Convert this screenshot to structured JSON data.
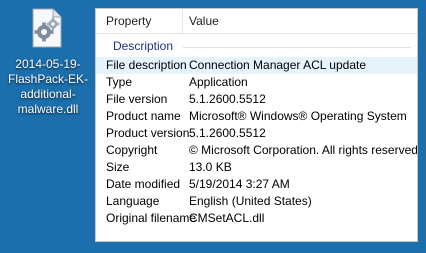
{
  "desktop_icon": {
    "icon": "dll-file-gear-icon",
    "label": "2014-05-19-FlashPack-EK-additional-malware.dll"
  },
  "properties": {
    "columns": [
      "Property",
      "Value"
    ],
    "section": "Description",
    "selected_row": 0,
    "rows": [
      {
        "property": "File description",
        "value": "Connection Manager ACL update"
      },
      {
        "property": "Type",
        "value": "Application"
      },
      {
        "property": "File version",
        "value": "5.1.2600.5512"
      },
      {
        "property": "Product name",
        "value": "Microsoft® Windows® Operating System"
      },
      {
        "property": "Product version",
        "value": "5.1.2600.5512"
      },
      {
        "property": "Copyright",
        "value": "© Microsoft Corporation. All rights reserved."
      },
      {
        "property": "Size",
        "value": "13.0 KB"
      },
      {
        "property": "Date modified",
        "value": "5/19/2014 3:27 AM"
      },
      {
        "property": "Language",
        "value": "English (United States)"
      },
      {
        "property": "Original filename",
        "value": "CMSetACL.dll"
      }
    ]
  }
}
